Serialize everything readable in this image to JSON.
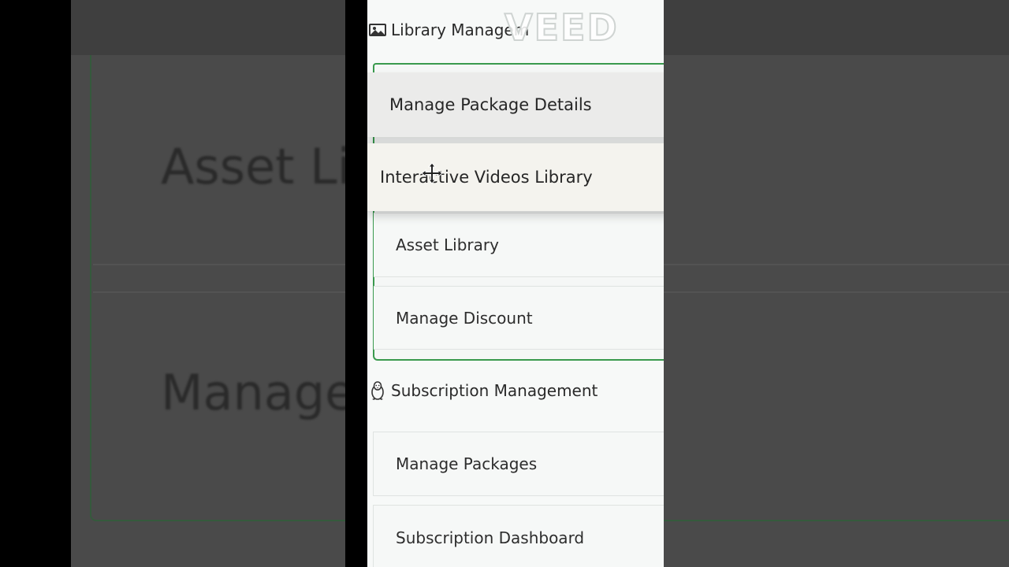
{
  "background": {
    "texts": [
      "Asset Lib",
      "Manage"
    ]
  },
  "library_section": {
    "icon": "image-icon",
    "title": "Library Managem"
  },
  "dragged_items": [
    "Manage Package Details",
    "Interactive Videos Library"
  ],
  "library_items": [
    "Asset Library",
    "Manage Discount"
  ],
  "subscription_section": {
    "icon": "linux-penguin-icon",
    "title": "Subscription Management"
  },
  "subscription_items": [
    "Manage Packages",
    "Subscription Dashboard"
  ],
  "watermark": "VEED",
  "colors": {
    "accent_border": "#3a9a4e",
    "panel_bg": "#f7f9f8"
  }
}
